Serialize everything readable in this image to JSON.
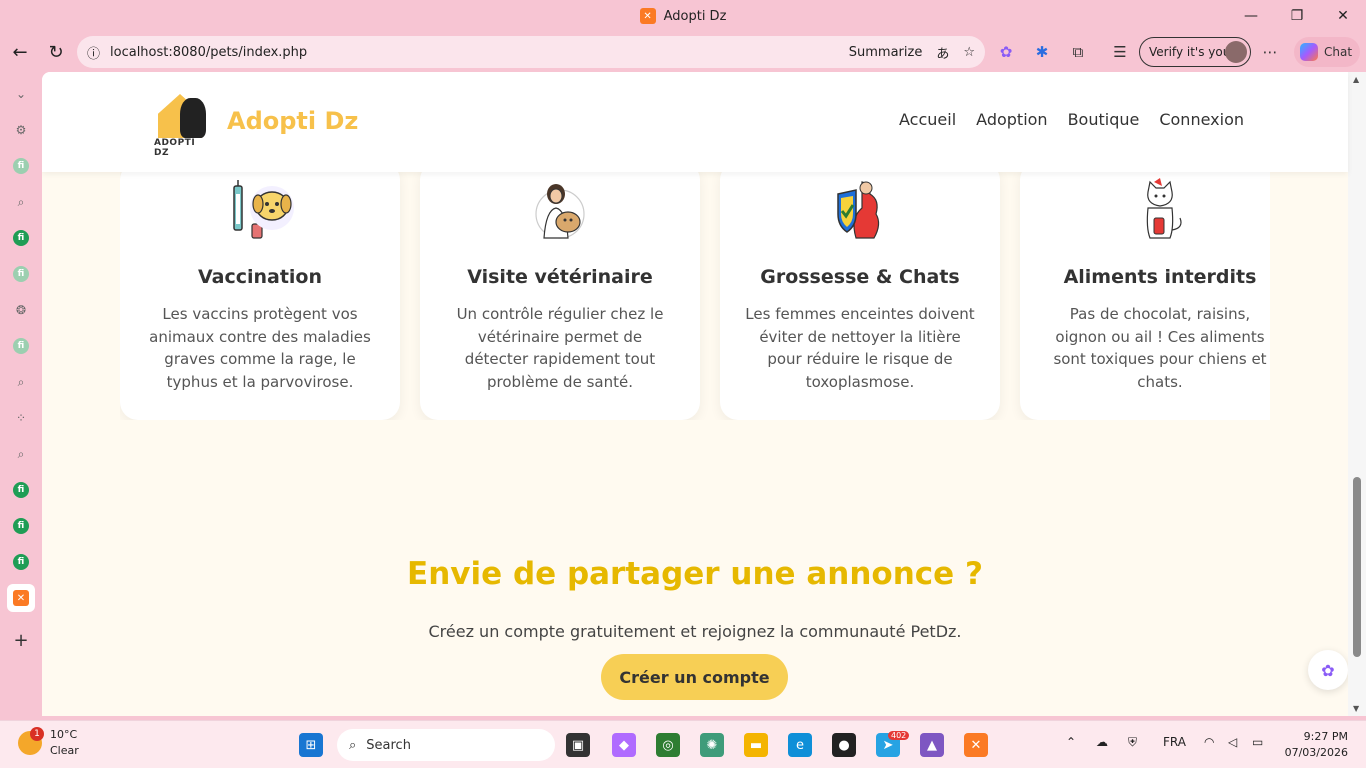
{
  "window": {
    "title": "Adopti Dz",
    "controls": [
      "—",
      "❐",
      "✕"
    ]
  },
  "browser": {
    "url": "localhost:8080/pets/index.php",
    "summarize_label": "Summarize",
    "verify_label": "Verify it's you",
    "chat_label": "Chat"
  },
  "site": {
    "brand": "Adopti Dz",
    "logo_caption": "ADOPTI DZ",
    "nav": [
      "Accueil",
      "Adoption",
      "Boutique",
      "Connexion"
    ]
  },
  "cards": [
    {
      "title": "Vaccination",
      "text": "Les vaccins protègent vos animaux contre des maladies graves comme la rage, le typhus et la parvovirose.",
      "icon": "vaccine-dog-icon"
    },
    {
      "title": "Visite vétérinaire",
      "text": "Un contrôle régulier chez le vétérinaire permet de détecter rapidement tout problème de santé.",
      "icon": "vet-visit-icon"
    },
    {
      "title": "Grossesse & Chats",
      "text": "Les femmes enceintes doivent éviter de nettoyer la litière pour réduire le risque de toxoplasmose.",
      "icon": "pregnancy-shield-icon"
    },
    {
      "title": "Aliments interdits",
      "text": "Pas de chocolat, raisins, oignon ou ail ! Ces aliments sont toxiques pour chiens et chats.",
      "icon": "forbidden-food-cat-icon"
    }
  ],
  "cta": {
    "title": "Envie de partager une annonce ?",
    "text": "Créez un compte gratuitement et rejoignez la communauté PetDz.",
    "button": "Créer un compte"
  },
  "taskbar": {
    "weather_temp": "10°C",
    "weather_desc": "Clear",
    "weather_badge": "1",
    "search_placeholder": "Search",
    "telegram_badge": "402",
    "lang": "FRA",
    "time": "9:27 PM",
    "date": "07/03/2026"
  },
  "colors": {
    "accent_yellow": "#f7c14b",
    "cta_yellow": "#e6b800",
    "page_bg": "#fffaf0",
    "chrome_pink": "#f7c5d3"
  }
}
